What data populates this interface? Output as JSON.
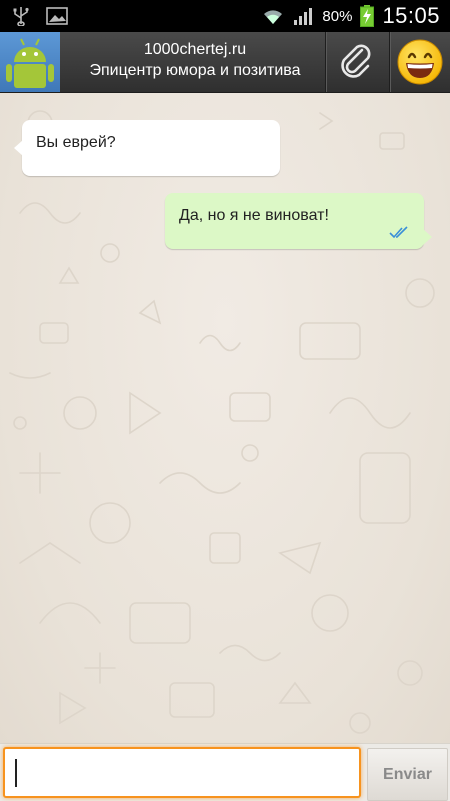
{
  "statusbar": {
    "battery_percent": "80%",
    "time": "15:05"
  },
  "header": {
    "contact_name": "1000chertej.ru",
    "status_line": "Эпицентр юмора и позитива"
  },
  "messages": [
    {
      "direction": "incoming",
      "text": "Вы еврей?"
    },
    {
      "direction": "outgoing",
      "text": "Да, но я не виноват!",
      "read_receipt": "double-check-icon"
    }
  ],
  "composer": {
    "value": "",
    "send_label": "Enviar"
  },
  "colors": {
    "outgoing_bubble": "#dcf8c6",
    "incoming_bubble": "#ffffff",
    "input_focus": "#f7931e",
    "read_ticks": "#3a8fd8"
  }
}
